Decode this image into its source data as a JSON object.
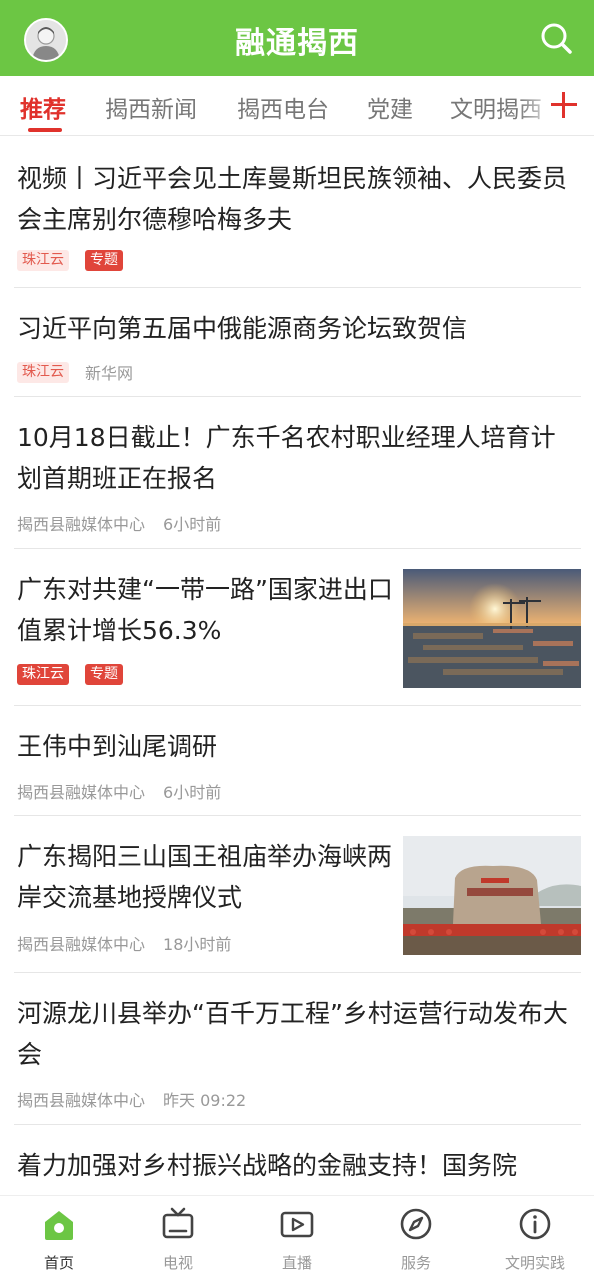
{
  "header": {
    "title": "融通揭西"
  },
  "tabs": [
    {
      "label": "推荐"
    },
    {
      "label": "揭西新闻"
    },
    {
      "label": "揭西电台"
    },
    {
      "label": "党建"
    },
    {
      "label": "文明揭西"
    }
  ],
  "feed": [
    {
      "title": "视频丨习近平会见土库曼斯坦民族领袖、人民委员会主席别尔德穆哈梅多夫",
      "badge1": "珠江云",
      "badge2": "专题"
    },
    {
      "title": "习近平向第五届中俄能源商务论坛致贺信",
      "badge1": "珠江云",
      "source": "新华网"
    },
    {
      "title": "10月18日截止！广东千名农村职业经理人培育计划首期班正在报名",
      "source": "揭西县融媒体中心",
      "time": "6小时前"
    },
    {
      "title": "广东对共建“一带一路”国家进出口值累计增长56.3%",
      "badge1": "珠江云",
      "badge2": "专题"
    },
    {
      "title": "王伟中到汕尾调研",
      "source": "揭西县融媒体中心",
      "time": "6小时前"
    },
    {
      "title": "广东揭阳三山国王祖庙举办海峡两岸交流基地授牌仪式",
      "source": "揭西县融媒体中心",
      "time": "18小时前"
    },
    {
      "title": "河源龙川县举办“百千万工程”乡村运营行动发布大会",
      "source": "揭西县融媒体中心",
      "time": "昨天 09:22"
    },
    {
      "title": "着力加强对乡村振兴战略的金融支持！国务院"
    }
  ],
  "nav": [
    {
      "label": "首页"
    },
    {
      "label": "电视"
    },
    {
      "label": "直播"
    },
    {
      "label": "服务"
    },
    {
      "label": "文明实践"
    }
  ],
  "colors": {
    "brand_green": "#6cc644",
    "accent_red": "#e0322c"
  },
  "icons": [
    "avatar-icon",
    "search-icon",
    "add-channel-icon",
    "home-icon",
    "tv-icon",
    "live-icon",
    "compass-icon",
    "info-icon"
  ]
}
